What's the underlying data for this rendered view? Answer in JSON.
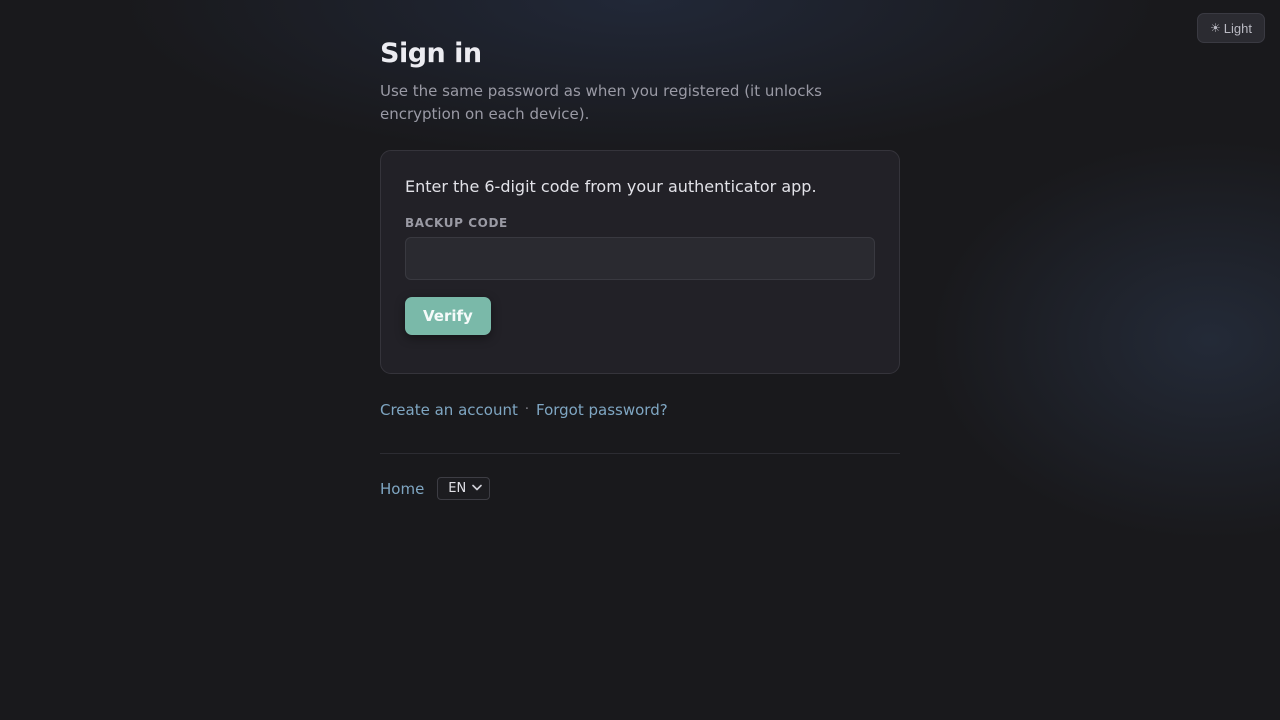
{
  "theme_toggle": {
    "icon": "sun-icon",
    "glyph": "☀",
    "label": "Light"
  },
  "heading": "Sign in",
  "subtitle": "Use the same password as when you registered (it unlocks encryption on each device).",
  "card": {
    "instructions": "Enter the 6-digit code from your authenticator app.",
    "field_label": "BACKUP CODE",
    "field_value": "",
    "verify_label": "Verify"
  },
  "links": {
    "create_account": "Create an account",
    "separator": "·",
    "forgot_password": "Forgot password?"
  },
  "footer": {
    "home": "Home",
    "language": "EN",
    "chevron": "⌄"
  },
  "colors": {
    "background": "#19191c",
    "accent": "#7ab9a9",
    "link": "#7fa6c2"
  }
}
